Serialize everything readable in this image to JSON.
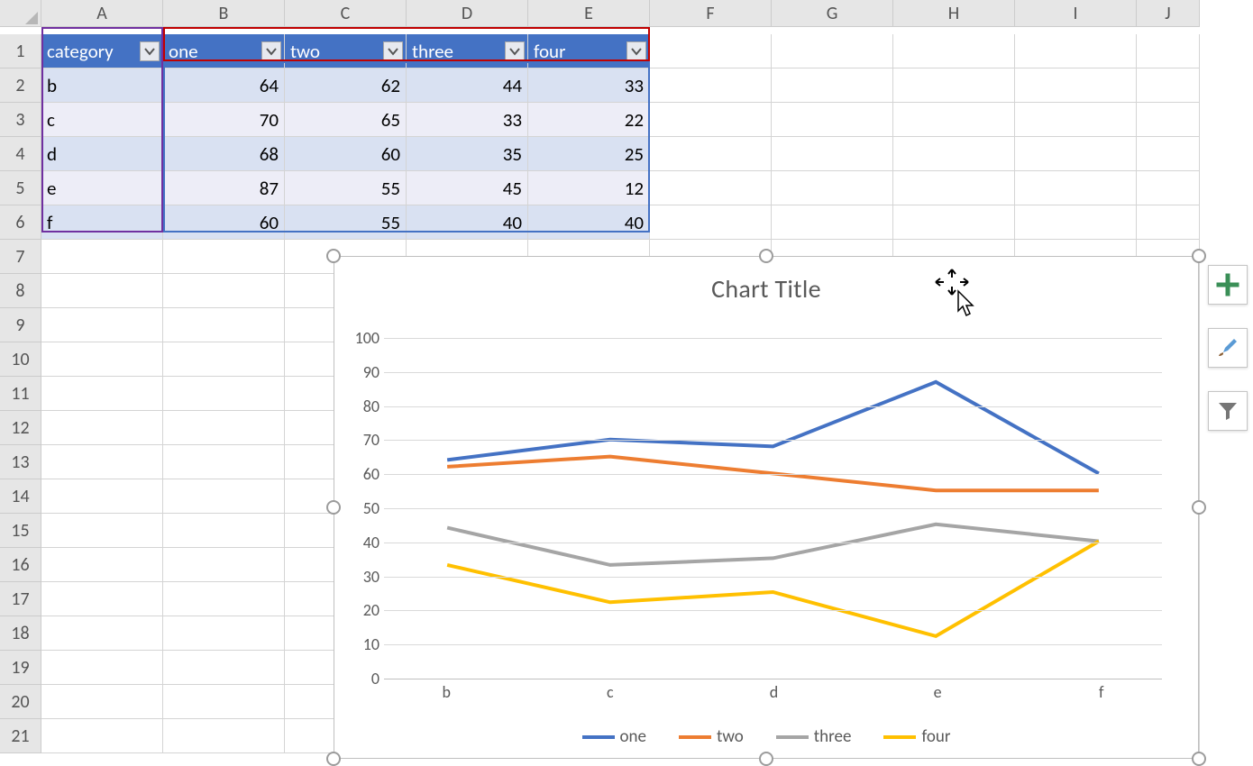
{
  "columns": [
    "A",
    "B",
    "C",
    "D",
    "E",
    "F",
    "G",
    "H",
    "I",
    "J"
  ],
  "row_count": 21,
  "table": {
    "headers": [
      "category",
      "one",
      "two",
      "three",
      "four"
    ],
    "rows": [
      {
        "cat": "b",
        "vals": [
          64,
          62,
          44,
          33
        ]
      },
      {
        "cat": "c",
        "vals": [
          70,
          65,
          33,
          22
        ]
      },
      {
        "cat": "d",
        "vals": [
          68,
          60,
          35,
          25
        ]
      },
      {
        "cat": "e",
        "vals": [
          87,
          55,
          45,
          12
        ]
      },
      {
        "cat": "f",
        "vals": [
          60,
          55,
          40,
          40
        ]
      }
    ]
  },
  "chart_title": "Chart Title",
  "y_ticks": [
    0,
    10,
    20,
    30,
    40,
    50,
    60,
    70,
    80,
    90,
    100
  ],
  "legend": [
    "one",
    "two",
    "three",
    "four"
  ],
  "series_colors": {
    "one": "#4472c4",
    "two": "#ed7d31",
    "three": "#a5a5a5",
    "four": "#ffc000"
  },
  "chart_data": {
    "type": "line",
    "title": "Chart Title",
    "xlabel": "",
    "ylabel": "",
    "ylim": [
      0,
      100
    ],
    "categories": [
      "b",
      "c",
      "d",
      "e",
      "f"
    ],
    "series": [
      {
        "name": "one",
        "values": [
          64,
          70,
          68,
          87,
          60
        ],
        "color": "#4472c4"
      },
      {
        "name": "two",
        "values": [
          62,
          65,
          60,
          55,
          55
        ],
        "color": "#ed7d31"
      },
      {
        "name": "three",
        "values": [
          44,
          33,
          35,
          45,
          40
        ],
        "color": "#a5a5a5"
      },
      {
        "name": "four",
        "values": [
          33,
          22,
          25,
          12,
          40
        ],
        "color": "#ffc000"
      }
    ]
  }
}
